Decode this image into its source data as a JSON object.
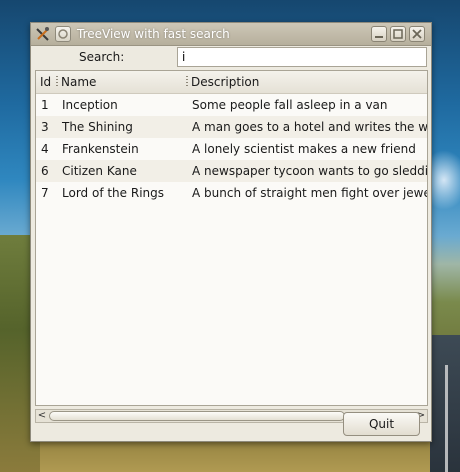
{
  "window": {
    "title": "TreeView with fast search"
  },
  "search": {
    "label": "Search:",
    "value": "i"
  },
  "table": {
    "columns": {
      "id": "Id",
      "name": "Name",
      "description": "Description"
    },
    "rows": [
      {
        "id": "1",
        "name": "Inception",
        "description": "Some people fall asleep in a van"
      },
      {
        "id": "3",
        "name": "The Shining",
        "description": "A man goes to a hotel and writes the wor:"
      },
      {
        "id": "4",
        "name": "Frankenstein",
        "description": "A lonely scientist makes a new friend"
      },
      {
        "id": "6",
        "name": "Citizen Kane",
        "description": "A newspaper tycoon wants to go sledding"
      },
      {
        "id": "7",
        "name": "Lord of the Rings",
        "description": "A bunch of straight men fight over jewelry"
      }
    ]
  },
  "scrollbar": {
    "left_arrow": "<",
    "right_arrow": ">"
  },
  "actions": {
    "quit_label": "Quit"
  }
}
